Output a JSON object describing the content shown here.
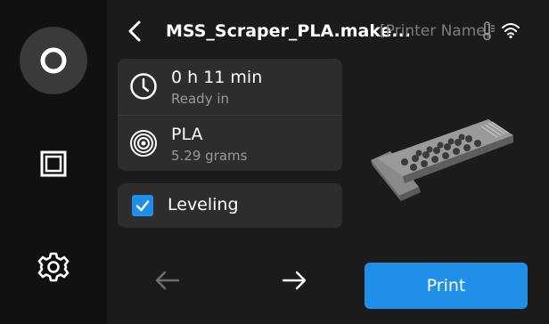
{
  "header": {
    "file_name": "MSS_Scraper_PLA.make...",
    "printer_name": "[Printer Name]",
    "back_icon": "chevron-left-icon",
    "status_icons": [
      "thermometer-icon",
      "wifi-icon"
    ]
  },
  "sidebar": {
    "items": [
      {
        "icon": "home-circle-icon",
        "active": true
      },
      {
        "icon": "file-icon",
        "active": false
      },
      {
        "icon": "gear-icon",
        "active": false
      }
    ]
  },
  "job": {
    "time_value": "0 h 11 min",
    "time_caption": "Ready in",
    "material_value": "PLA",
    "material_caption": "5.29 grams"
  },
  "leveling": {
    "label": "Leveling",
    "checked": true
  },
  "actions": {
    "print_label": "Print",
    "prev_icon": "arrow-left-icon",
    "next_icon": "arrow-right-icon"
  },
  "colors": {
    "accent": "#1f8fe8",
    "background": "#1b1b1b",
    "sidebar": "#111111",
    "card": "#2d2d2d",
    "muted_text": "#7d7d7d"
  }
}
